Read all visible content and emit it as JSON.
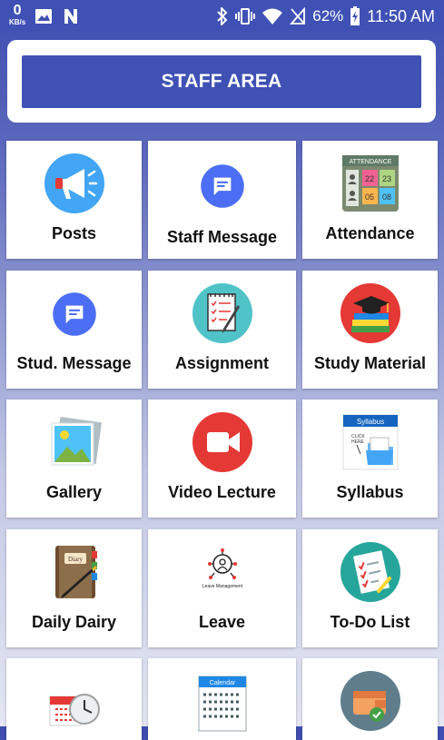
{
  "status_bar": {
    "net_speed_value": "0",
    "net_speed_unit": "KB/s",
    "battery": "62%",
    "time": "11:50 AM"
  },
  "header": {
    "title": "STAFF AREA"
  },
  "tiles": [
    {
      "label": "Posts",
      "icon": "megaphone-icon"
    },
    {
      "label": "Staff Message",
      "icon": "chat-bubble-icon"
    },
    {
      "label": "Attendance",
      "icon": "attendance-board-icon"
    },
    {
      "label": "Stud. Message",
      "icon": "chat-bubble-icon"
    },
    {
      "label": "Assignment",
      "icon": "notepad-pen-icon"
    },
    {
      "label": "Study Material",
      "icon": "books-graduation-cap-icon"
    },
    {
      "label": "Gallery",
      "icon": "picture-gallery-icon"
    },
    {
      "label": "Video Lecture",
      "icon": "video-camera-icon"
    },
    {
      "label": "Syllabus",
      "icon": "syllabus-folder-icon"
    },
    {
      "label": "Daily Dairy",
      "icon": "diary-book-icon"
    },
    {
      "label": "Leave",
      "icon": "leave-management-icon"
    },
    {
      "label": "To-Do List",
      "icon": "checklist-icon"
    },
    {
      "label": "",
      "icon": "calendar-clock-icon"
    },
    {
      "label": "",
      "icon": "calendar-grid-icon"
    },
    {
      "label": "",
      "icon": "wallet-check-icon"
    }
  ],
  "leave_icon_caption": "Leave Management",
  "attendance_icon_caption": "ATTENDANCE",
  "syllabus_icon_caption": "Syllabus",
  "diary_icon_caption": "Diary",
  "calendar_icon_caption": "Calendar",
  "colors": {
    "primary": "#3f51b5",
    "tile_bg": "#ffffff"
  }
}
